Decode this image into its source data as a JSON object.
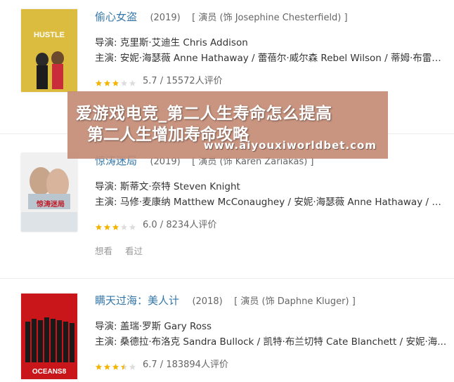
{
  "movies": [
    {
      "title": "偷心女盗",
      "year": "(2019)",
      "role": "[ 演员 (饰 Josephine Chesterfield) ]",
      "director": "导演: 克里斯·艾迪生 Chris Addison",
      "cast": "主演: 安妮·海瑟薇 Anne Hathaway / 蕾蓓尔·威尔森 Rebel Wilson / 蒂姆·布雷克...",
      "stars": 3,
      "rating": "5.7 / 15572人评价",
      "poster_text": "HUSTLE"
    },
    {
      "title": "惊涛迷局",
      "year": "(2019)",
      "role": "[ 演员 (饰 Karen Zariakas) ]",
      "director": "导演: 斯蒂文·奈特 Steven Knight",
      "cast": "主演: 马修·麦康纳 Matthew McConaughey / 安妮·海瑟薇 Anne Hathaway / 戴安·琳...",
      "stars": 3,
      "rating": "6.0 / 8234人评价",
      "actions": [
        "想看",
        "看过"
      ],
      "poster_text": "惊涛迷局"
    },
    {
      "title": "瞒天过海：美人计",
      "year": "(2018)",
      "role": "[ 演员 (饰 Daphne Kluger) ]",
      "director": "导演: 盖瑞·罗斯 Gary Ross",
      "cast": "主演: 桑德拉·布洛克 Sandra Bullock / 凯特·布兰切特 Cate Blanchett / 安妮·海...",
      "stars": 3.5,
      "rating": "6.7 / 183894人评价",
      "poster_text": "OCEANS8"
    }
  ],
  "watermark": {
    "line1": "爱游戏电竞_第二人生寿命怎么提高",
    "line2": "第二人生增加寿命攻略",
    "url": "www.aiyouxiworldbet.com"
  },
  "colors": {
    "link": "#3377aa",
    "star": "#f4b400",
    "overlay": "#c48c76"
  }
}
